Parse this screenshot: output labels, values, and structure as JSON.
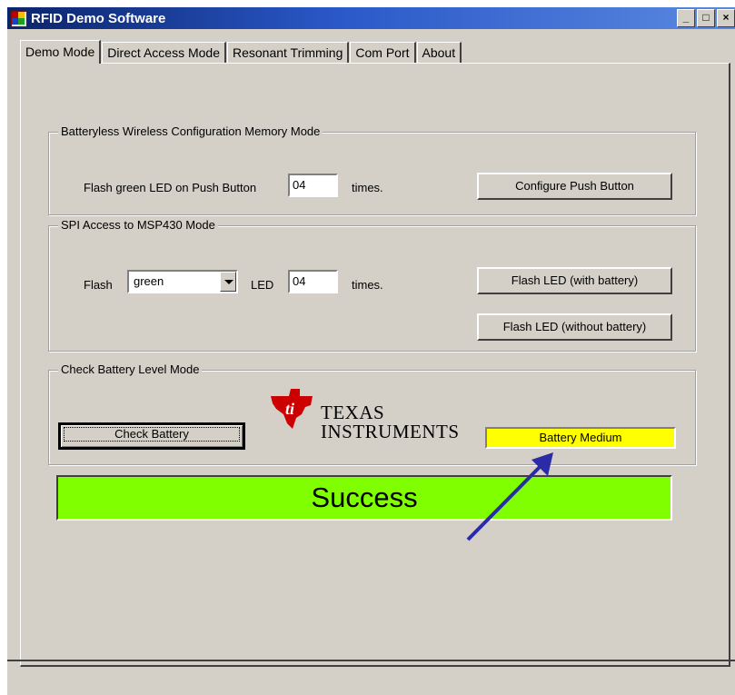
{
  "window": {
    "title": "RFID Demo Software",
    "controls": [
      "_",
      "□",
      "×"
    ]
  },
  "tabs": [
    {
      "label": "Demo Mode",
      "active": true
    },
    {
      "label": "Direct Access Mode",
      "active": false
    },
    {
      "label": "Resonant Trimming",
      "active": false
    },
    {
      "label": "Com Port",
      "active": false
    },
    {
      "label": "About",
      "active": false
    }
  ],
  "batteryless": {
    "legend": "Batteryless Wireless  Configuration Memory Mode",
    "flash_label": "Flash green LED on Push Button",
    "count_value": "04",
    "times_label": "times.",
    "configure_button": "Configure Push Button"
  },
  "spi": {
    "legend": "SPI Access to MSP430 Mode",
    "flash_label": "Flash",
    "color_selected": "green",
    "led_label": "LED",
    "count_value": "04",
    "times_label": "times.",
    "flash_with_battery": "Flash LED (with battery)",
    "flash_without_battery": "Flash LED (without battery)"
  },
  "battery": {
    "legend": "Check Battery Level Mode",
    "check_button": "Check Battery",
    "status": "Battery Medium",
    "status_color": "#ffff00"
  },
  "logo": {
    "line1": "TEXAS",
    "line2": "INSTRUMENTS",
    "color": "#cc0000"
  },
  "result": {
    "text": "Success",
    "color": "#80ff00"
  },
  "annotation": {
    "arrow_color": "#2b2ba8"
  }
}
